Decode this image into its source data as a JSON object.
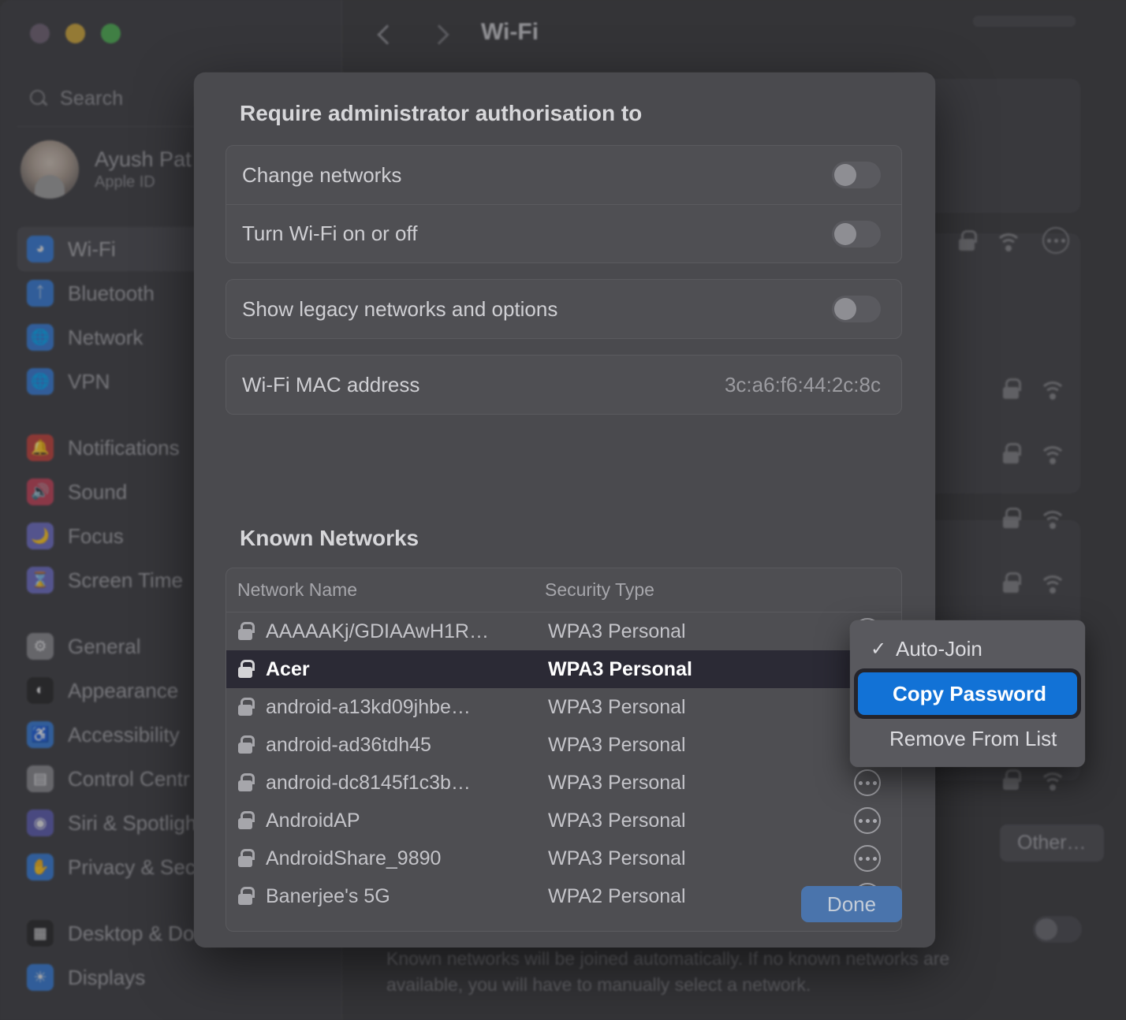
{
  "window": {
    "title": "Wi-Fi",
    "back_icon": "chevron-left-icon",
    "forward_icon": "chevron-right-icon"
  },
  "sidebar": {
    "search_placeholder": "Search",
    "account": {
      "name": "Ayush Pat",
      "subtitle": "Apple ID"
    },
    "items": [
      {
        "label": "Wi-Fi",
        "icon": "wifi-icon",
        "color": "#3a7dd6",
        "selected": true
      },
      {
        "label": "Bluetooth",
        "icon": "bluetooth-icon",
        "color": "#3a7dd6",
        "selected": false
      },
      {
        "label": "Network",
        "icon": "globe-icon",
        "color": "#3a7dd6",
        "selected": false
      },
      {
        "label": "VPN",
        "icon": "vpn-globe-icon",
        "color": "#3a7dd6",
        "selected": false
      },
      {
        "label": "Notifications",
        "icon": "bell-icon",
        "color": "#c1453f",
        "selected": false
      },
      {
        "label": "Sound",
        "icon": "speaker-icon",
        "color": "#c1455a",
        "selected": false
      },
      {
        "label": "Focus",
        "icon": "moon-icon",
        "color": "#6f6fc4",
        "selected": false
      },
      {
        "label": "Screen Time",
        "icon": "hourglass-icon",
        "color": "#6f6fc4",
        "selected": false
      },
      {
        "label": "General",
        "icon": "gear-icon",
        "color": "#8a8a8f",
        "selected": false
      },
      {
        "label": "Appearance",
        "icon": "appearance-icon",
        "color": "#2c2c2e",
        "selected": false
      },
      {
        "label": "Accessibility",
        "icon": "accessibility-icon",
        "color": "#3a7dd6",
        "selected": false
      },
      {
        "label": "Control Centr",
        "icon": "control-centre-icon",
        "color": "#8a8a8f",
        "selected": false
      },
      {
        "label": "Siri & Spotligh",
        "icon": "siri-icon",
        "color": "#5f5fb0",
        "selected": false
      },
      {
        "label": "Privacy & Sec",
        "icon": "hand-icon",
        "color": "#3a7dd6",
        "selected": false
      },
      {
        "label": "Desktop & Do",
        "icon": "desktop-dock-icon",
        "color": "#2c2c2e",
        "selected": false
      },
      {
        "label": "Displays",
        "icon": "brightness-icon",
        "color": "#3a7dd6",
        "selected": false
      }
    ]
  },
  "sheet": {
    "title": "Require administrator authorisation to",
    "admin_rows": [
      {
        "label": "Change networks",
        "toggle": "off"
      },
      {
        "label": "Turn Wi-Fi on or off",
        "toggle": "off"
      }
    ],
    "legacy_row": {
      "label": "Show legacy networks and options",
      "toggle": "off"
    },
    "mac_row": {
      "label": "Wi-Fi MAC address",
      "value": "3c:a6:f6:44:2c:8c"
    },
    "known_networks_title": "Known Networks",
    "table": {
      "columns": [
        "Network Name",
        "Security Type"
      ],
      "rows": [
        {
          "name": "AAAAAKj/GDIAAwH1R…",
          "security": "WPA3 Personal",
          "locked": true,
          "selected": false
        },
        {
          "name": "Acer",
          "security": "WPA3 Personal",
          "locked": true,
          "selected": true
        },
        {
          "name": "android-a13kd09jhbe…",
          "security": "WPA3 Personal",
          "locked": true,
          "selected": false
        },
        {
          "name": "android-ad36tdh45",
          "security": "WPA3 Personal",
          "locked": true,
          "selected": false
        },
        {
          "name": "android-dc8145f1c3b…",
          "security": "WPA3 Personal",
          "locked": true,
          "selected": false
        },
        {
          "name": "AndroidAP",
          "security": "WPA3 Personal",
          "locked": true,
          "selected": false
        },
        {
          "name": "AndroidShare_9890",
          "security": "WPA3 Personal",
          "locked": true,
          "selected": false
        },
        {
          "name": "Banerjee's 5G",
          "security": "WPA2 Personal",
          "locked": true,
          "selected": false
        }
      ]
    },
    "done_label": "Done"
  },
  "context_menu": {
    "items": [
      {
        "label": "Auto-Join",
        "checked": true,
        "highlighted": false
      },
      {
        "label": "Copy Password",
        "checked": false,
        "highlighted": true
      },
      {
        "label": "Remove From List",
        "checked": false,
        "highlighted": false
      }
    ],
    "check_glyph": "✓",
    "highlight_color": "#1272d6"
  },
  "background": {
    "caption": "Known networks will be joined automatically. If no known networks are available, you will have to manually select a network.",
    "other_button": "Other…"
  }
}
